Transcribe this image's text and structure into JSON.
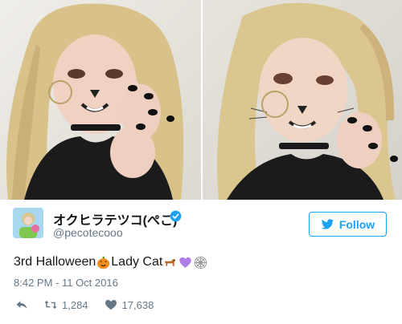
{
  "tweet": {
    "display_name": "オクヒラテツコ(ぺこ)",
    "handle": "@pecotecooo",
    "follow_label": "Follow",
    "text_part1": "3rd Halloween",
    "text_part2": "Lady Cat",
    "emojis": [
      "jack-o-lantern-icon",
      "dog-icon",
      "purple-heart-icon",
      "spider-web-icon"
    ],
    "timestamp": "8:42 PM - 11 Oct 2016",
    "retweet_count": "1,284",
    "like_count": "17,638"
  },
  "colors": {
    "accent": "#1da1f2",
    "text": "#14171a",
    "muted": "#657786",
    "purple_heart": "#b07ee6",
    "pumpkin": "#f28c1b",
    "dog": "#b5651d"
  }
}
